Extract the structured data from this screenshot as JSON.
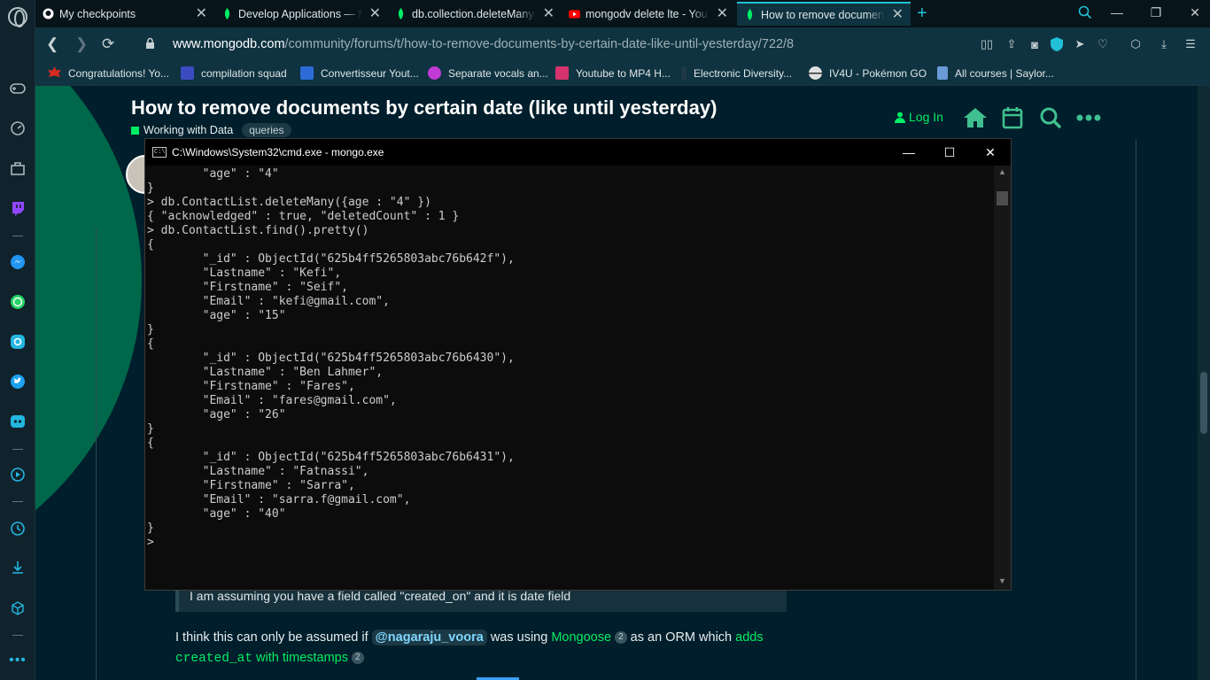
{
  "browser": {
    "tabs": [
      {
        "title": "My checkpoints",
        "icon": "github-icon"
      },
      {
        "title": "Develop Applications — M",
        "icon": "mongodb-leaf-icon"
      },
      {
        "title": "db.collection.deleteMany()",
        "icon": "mongodb-leaf-icon"
      },
      {
        "title": "mongodv delete lte - YouTu",
        "icon": "youtube-icon"
      },
      {
        "title": "How to remove documents",
        "icon": "mongodb-leaf-icon",
        "active": true
      }
    ],
    "new_tab_label": "+",
    "url_domain": "www.mongodb.com",
    "url_path": "/community/forums/t/how-to-remove-documents-by-certain-date-like-until-yesterday/722/8",
    "bookmarks": [
      {
        "label": "Congratulations! Yo...",
        "color": "#d62b1f"
      },
      {
        "label": "compilation squad",
        "color": "#3b4cc0"
      },
      {
        "label": "Convertisseur Yout...",
        "color": "#2d6bd6"
      },
      {
        "label": "Separate vocals an...",
        "color": "#c23bd6"
      },
      {
        "label": "Youtube to MP4 H...",
        "color": "#d6336c"
      },
      {
        "label": "Electronic Diversity...",
        "color": "#1e3a46"
      },
      {
        "label": "IV4U - Pokémon GO",
        "color": "#e0e0e0"
      },
      {
        "label": "All courses | Saylor...",
        "color": "#6b9bd6"
      }
    ]
  },
  "forum": {
    "title": "How to remove documents by certain date (like until yesterday)",
    "category": "Working with Data",
    "tag": "queries",
    "login": "Log In",
    "quote": "I am assuming you have a field called \"created_on\" and it is date field",
    "para_1": "I think this can only be assumed if",
    "mention": "@nagaraju_voora",
    "para_2": "was using",
    "mongoose": "Mongoose",
    "badge_1": "2",
    "para_3": "as an ORM which",
    "adds": "adds",
    "code": "created_at",
    "with_ts": "with timestamps",
    "badge_2": "2"
  },
  "cmd": {
    "title": "C:\\Windows\\System32\\cmd.exe - mongo.exe",
    "icon_text": "C:\\",
    "lines": [
      "        \"age\" : \"4\"",
      "}",
      "> db.ContactList.deleteMany({age : \"4\" })",
      "{ \"acknowledged\" : true, \"deletedCount\" : 1 }",
      "> db.ContactList.find().pretty()",
      "{",
      "        \"_id\" : ObjectId(\"625b4ff5265803abc76b642f\"),",
      "        \"Lastname\" : \"Kefi\",",
      "        \"Firstname\" : \"Seif\",",
      "        \"Email\" : \"kefi@gmail.com\",",
      "        \"age\" : \"15\"",
      "}",
      "{",
      "        \"_id\" : ObjectId(\"625b4ff5265803abc76b6430\"),",
      "        \"Lastname\" : \"Ben Lahmer\",",
      "        \"Firstname\" : \"Fares\",",
      "        \"Email\" : \"fares@gmail.com\",",
      "        \"age\" : \"26\"",
      "}",
      "{",
      "        \"_id\" : ObjectId(\"625b4ff5265803abc76b6431\"),",
      "        \"Lastname\" : \"Fatnassi\",",
      "        \"Firstname\" : \"Sarra\",",
      "        \"Email\" : \"sarra.f@gmail.com\",",
      "        \"age\" : \"40\"",
      "}",
      "> "
    ]
  },
  "colors": {
    "mongo_green": "#00ed64",
    "page_bg": "#001e2b",
    "accent_cyan": "#21c0d6"
  }
}
